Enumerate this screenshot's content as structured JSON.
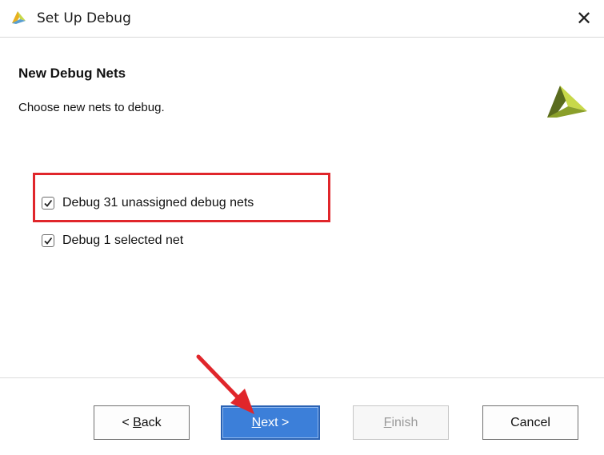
{
  "window": {
    "title": "Set Up Debug",
    "close_glyph": "✕",
    "title_icon": "vivado-logo-icon"
  },
  "header": {
    "title": "New Debug Nets",
    "subtitle": "Choose new nets to debug.",
    "logo_icon": "vivado-logo-icon"
  },
  "options": [
    {
      "label": "Debug 31 unassigned debug nets",
      "checked": true,
      "highlighted": true
    },
    {
      "label": "Debug 1 selected net",
      "checked": true,
      "highlighted": false
    }
  ],
  "buttons": {
    "back": {
      "prefix": "< ",
      "mnemonic": "B",
      "rest": "ack"
    },
    "next": {
      "mnemonic": "N",
      "rest": "ext >"
    },
    "finish": {
      "mnemonic": "F",
      "rest": "inish",
      "enabled": false
    },
    "cancel": {
      "label": "Cancel"
    }
  },
  "colors": {
    "accent_blue": "#3c7fd9",
    "highlight_red": "#e0262b",
    "logo_dark": "#5a6b1e",
    "logo_light": "#c8d84a"
  },
  "annotations": {
    "highlight_box": "red-rectangle",
    "arrow_target": "next-button"
  }
}
